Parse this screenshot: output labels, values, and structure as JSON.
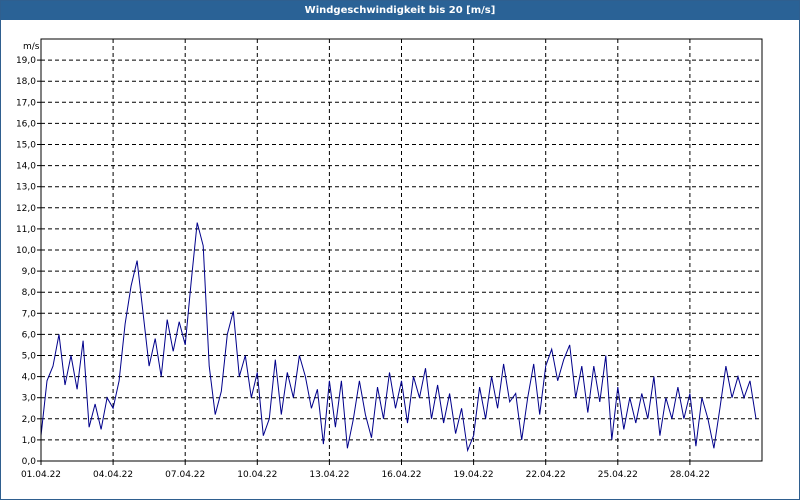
{
  "window": {
    "title": "Windgeschwindigkeit bis 20 [m/s]"
  },
  "chart_data": {
    "type": "line",
    "title": "Windgeschwindigkeit bis 20 [m/s]",
    "ylabel": "m/s",
    "ylim": [
      0,
      20
    ],
    "xlim": [
      "01.04.22 00:00",
      "01.05.22 00:00"
    ],
    "y_ticks": [
      "0,0",
      "1,0",
      "2,0",
      "3,0",
      "4,0",
      "5,0",
      "6,0",
      "7,0",
      "8,0",
      "9,0",
      "10,0",
      "11,0",
      "12,0",
      "13,0",
      "14,0",
      "15,0",
      "16,0",
      "17,0",
      "18,0",
      "19,0"
    ],
    "x_ticks": [
      "01.04.22",
      "04.04.22",
      "07.04.22",
      "10.04.22",
      "13.04.22",
      "16.04.22",
      "19.04.22",
      "22.04.22",
      "25.04.22",
      "28.04.22"
    ],
    "grid": true,
    "line_color": "#00008b",
    "series": [
      {
        "points": [
          [
            "01.04.22 00:00",
            1.2
          ],
          [
            "01.04.22 06:00",
            3.8
          ],
          [
            "01.04.22 12:00",
            4.5
          ],
          [
            "01.04.22 18:00",
            6.0
          ],
          [
            "02.04.22 00:00",
            3.6
          ],
          [
            "02.04.22 06:00",
            5.0
          ],
          [
            "02.04.22 12:00",
            3.4
          ],
          [
            "02.04.22 18:00",
            5.7
          ],
          [
            "03.04.22 00:00",
            1.6
          ],
          [
            "03.04.22 06:00",
            2.7
          ],
          [
            "03.04.22 12:00",
            1.5
          ],
          [
            "03.04.22 18:00",
            3.0
          ],
          [
            "04.04.22 00:00",
            2.5
          ],
          [
            "04.04.22 06:00",
            3.8
          ],
          [
            "04.04.22 12:00",
            6.5
          ],
          [
            "04.04.22 18:00",
            8.3
          ],
          [
            "05.04.22 00:00",
            9.5
          ],
          [
            "05.04.22 06:00",
            7.0
          ],
          [
            "05.04.22 12:00",
            4.5
          ],
          [
            "05.04.22 18:00",
            5.8
          ],
          [
            "06.04.22 00:00",
            4.0
          ],
          [
            "06.04.22 06:00",
            6.7
          ],
          [
            "06.04.22 12:00",
            5.2
          ],
          [
            "06.04.22 18:00",
            6.6
          ],
          [
            "07.04.22 00:00",
            5.5
          ],
          [
            "07.04.22 06:00",
            8.5
          ],
          [
            "07.04.22 12:00",
            11.3
          ],
          [
            "07.04.22 18:00",
            10.2
          ],
          [
            "08.04.22 00:00",
            4.5
          ],
          [
            "08.04.22 06:00",
            2.2
          ],
          [
            "08.04.22 12:00",
            3.3
          ],
          [
            "08.04.22 18:00",
            6.0
          ],
          [
            "09.04.22 00:00",
            7.1
          ],
          [
            "09.04.22 06:00",
            4.0
          ],
          [
            "09.04.22 12:00",
            5.0
          ],
          [
            "09.04.22 18:00",
            3.0
          ],
          [
            "10.04.22 00:00",
            4.2
          ],
          [
            "10.04.22 06:00",
            1.2
          ],
          [
            "10.04.22 12:00",
            2.0
          ],
          [
            "10.04.22 18:00",
            4.8
          ],
          [
            "11.04.22 00:00",
            2.2
          ],
          [
            "11.04.22 06:00",
            4.2
          ],
          [
            "11.04.22 12:00",
            3.0
          ],
          [
            "11.04.22 18:00",
            5.0
          ],
          [
            "12.04.22 00:00",
            4.0
          ],
          [
            "12.04.22 06:00",
            2.5
          ],
          [
            "12.04.22 12:00",
            3.4
          ],
          [
            "12.04.22 18:00",
            0.8
          ],
          [
            "13.04.22 00:00",
            3.8
          ],
          [
            "13.04.22 06:00",
            1.6
          ],
          [
            "13.04.22 12:00",
            3.8
          ],
          [
            "13.04.22 18:00",
            0.6
          ],
          [
            "14.04.22 00:00",
            2.0
          ],
          [
            "14.04.22 06:00",
            3.8
          ],
          [
            "14.04.22 12:00",
            2.2
          ],
          [
            "14.04.22 18:00",
            1.1
          ],
          [
            "15.04.22 00:00",
            3.5
          ],
          [
            "15.04.22 06:00",
            2.0
          ],
          [
            "15.04.22 12:00",
            4.2
          ],
          [
            "15.04.22 18:00",
            2.5
          ],
          [
            "16.04.22 00:00",
            3.8
          ],
          [
            "16.04.22 06:00",
            1.8
          ],
          [
            "16.04.22 12:00",
            4.0
          ],
          [
            "16.04.22 18:00",
            3.0
          ],
          [
            "17.04.22 00:00",
            4.4
          ],
          [
            "17.04.22 06:00",
            2.0
          ],
          [
            "17.04.22 12:00",
            3.6
          ],
          [
            "17.04.22 18:00",
            1.8
          ],
          [
            "18.04.22 00:00",
            3.2
          ],
          [
            "18.04.22 06:00",
            1.3
          ],
          [
            "18.04.22 12:00",
            2.5
          ],
          [
            "18.04.22 18:00",
            0.5
          ],
          [
            "19.04.22 00:00",
            1.2
          ],
          [
            "19.04.22 06:00",
            3.5
          ],
          [
            "19.04.22 12:00",
            2.0
          ],
          [
            "19.04.22 18:00",
            4.0
          ],
          [
            "20.04.22 00:00",
            2.5
          ],
          [
            "20.04.22 06:00",
            4.6
          ],
          [
            "20.04.22 12:00",
            2.8
          ],
          [
            "20.04.22 18:00",
            3.2
          ],
          [
            "21.04.22 00:00",
            1.0
          ],
          [
            "21.04.22 06:00",
            3.0
          ],
          [
            "21.04.22 12:00",
            4.6
          ],
          [
            "21.04.22 18:00",
            2.2
          ],
          [
            "22.04.22 00:00",
            4.5
          ],
          [
            "22.04.22 06:00",
            5.3
          ],
          [
            "22.04.22 12:00",
            3.8
          ],
          [
            "22.04.22 18:00",
            4.8
          ],
          [
            "23.04.22 00:00",
            5.5
          ],
          [
            "23.04.22 06:00",
            3.0
          ],
          [
            "23.04.22 12:00",
            4.5
          ],
          [
            "23.04.22 18:00",
            2.3
          ],
          [
            "24.04.22 00:00",
            4.5
          ],
          [
            "24.04.22 06:00",
            2.8
          ],
          [
            "24.04.22 12:00",
            5.0
          ],
          [
            "24.04.22 18:00",
            1.0
          ],
          [
            "25.04.22 00:00",
            3.5
          ],
          [
            "25.04.22 06:00",
            1.5
          ],
          [
            "25.04.22 12:00",
            3.0
          ],
          [
            "25.04.22 18:00",
            1.8
          ],
          [
            "26.04.22 00:00",
            3.2
          ],
          [
            "26.04.22 06:00",
            2.0
          ],
          [
            "26.04.22 12:00",
            4.0
          ],
          [
            "26.04.22 18:00",
            1.2
          ],
          [
            "27.04.22 00:00",
            3.0
          ],
          [
            "27.04.22 06:00",
            2.0
          ],
          [
            "27.04.22 12:00",
            3.5
          ],
          [
            "27.04.22 18:00",
            2.0
          ],
          [
            "28.04.22 00:00",
            3.2
          ],
          [
            "28.04.22 06:00",
            0.7
          ],
          [
            "28.04.22 12:00",
            3.0
          ],
          [
            "28.04.22 18:00",
            2.0
          ],
          [
            "29.04.22 00:00",
            0.6
          ],
          [
            "29.04.22 06:00",
            2.5
          ],
          [
            "29.04.22 12:00",
            4.5
          ],
          [
            "29.04.22 18:00",
            3.0
          ],
          [
            "30.04.22 00:00",
            4.0
          ],
          [
            "30.04.22 06:00",
            3.0
          ],
          [
            "30.04.22 12:00",
            3.8
          ],
          [
            "30.04.22 18:00",
            2.0
          ]
        ]
      }
    ]
  }
}
